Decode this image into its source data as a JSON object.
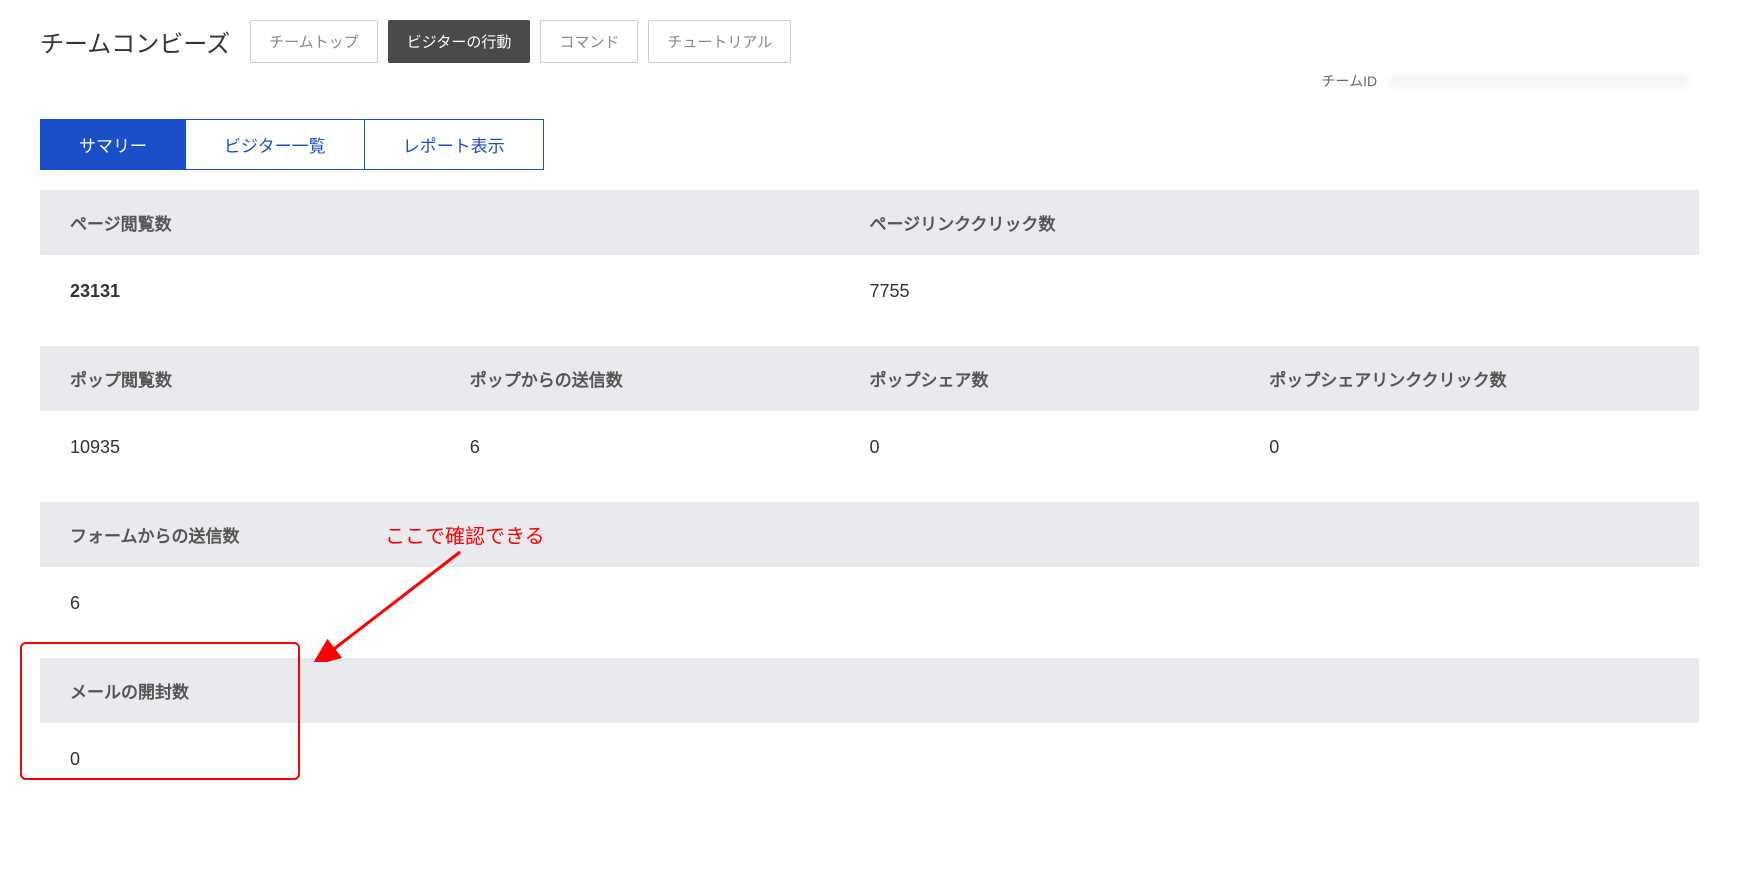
{
  "header": {
    "team_title": "チームコンビーズ",
    "nav": {
      "team_top": "チームトップ",
      "visitor_behavior": "ビジターの行動",
      "command": "コマンド",
      "tutorial": "チュートリアル"
    },
    "teamid_label": "チームID"
  },
  "tabs": {
    "summary": "サマリー",
    "visitor_list": "ビジター一覧",
    "report_view": "レポート表示"
  },
  "section1": {
    "h_page_views": "ページ閲覧数",
    "h_page_link_clicks": "ページリンククリック数",
    "v_page_views": "23131",
    "v_page_link_clicks": "7755"
  },
  "section2": {
    "h_pop_views": "ポップ閲覧数",
    "h_pop_send": "ポップからの送信数",
    "h_pop_share": "ポップシェア数",
    "h_pop_share_link_click": "ポップシェアリンククリック数",
    "v_pop_views": "10935",
    "v_pop_send": "6",
    "v_pop_share": "0",
    "v_pop_share_link_click": "0"
  },
  "section3": {
    "h_form_send": "フォームからの送信数",
    "v_form_send": "6"
  },
  "section4": {
    "h_mail_open": "メールの開封数",
    "v_mail_open": "0"
  },
  "annotation": {
    "text": "ここで確認できる"
  }
}
